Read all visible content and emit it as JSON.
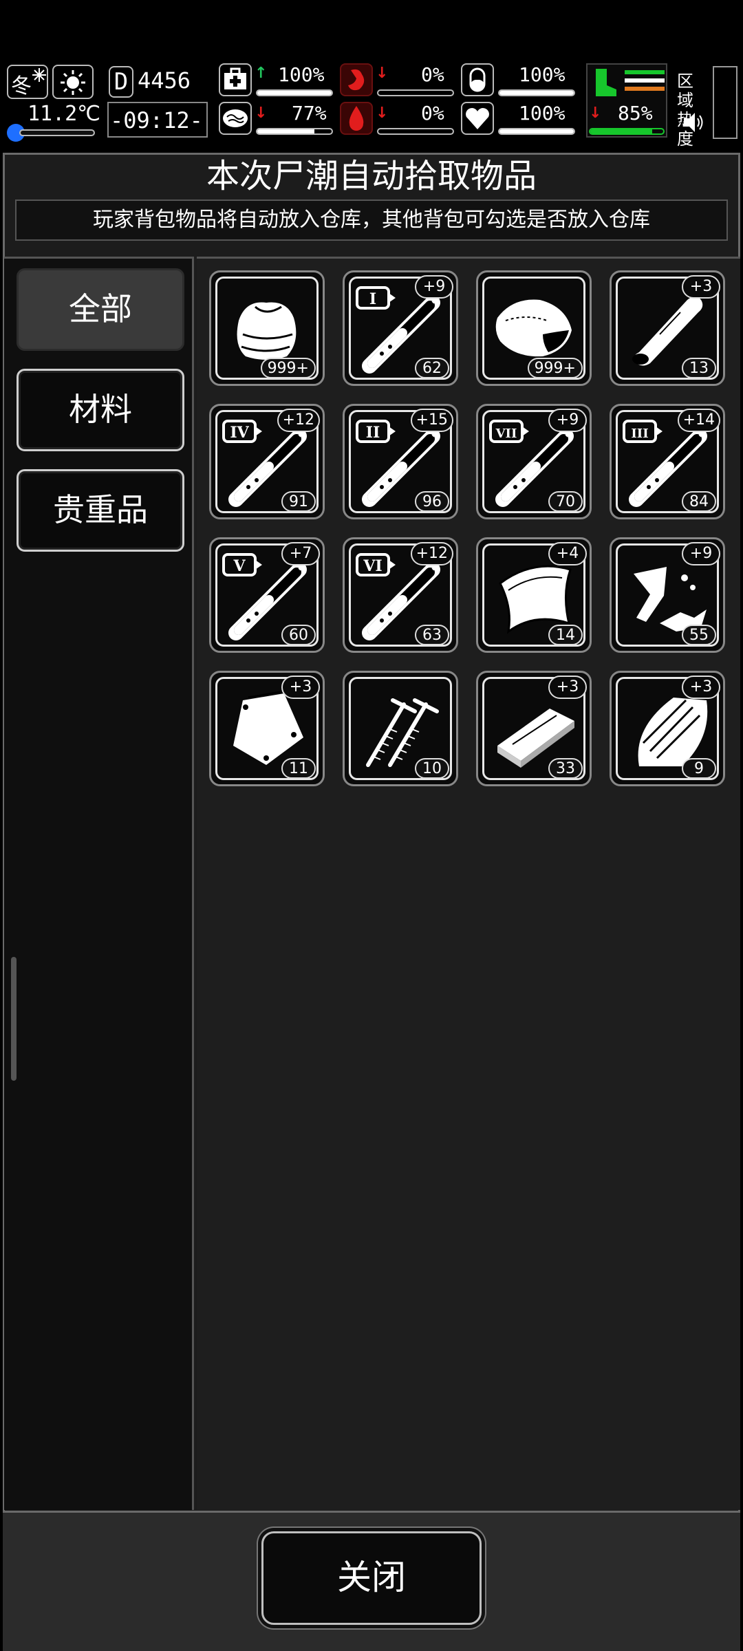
{
  "hud": {
    "season": "冬",
    "temperature": "11.2℃",
    "day": "4456",
    "time": "-09:12-",
    "stats": {
      "health": "100%",
      "stomach": "0%",
      "pill": "100%",
      "brain": "77%",
      "blood": "0%",
      "heart": "100%",
      "stamina": "85%"
    },
    "fills": {
      "health": 1.0,
      "stomach": 0.0,
      "pill": 1.0,
      "brain": 0.77,
      "blood": 0.0,
      "heart": 1.0,
      "stamina": 0.85
    },
    "zone_label": "区域热度",
    "colors": {
      "up": "#22c55e",
      "down": "#e11d1d",
      "accent_green": "#17c62c",
      "accent_orange": "#e07a1f"
    }
  },
  "dialog": {
    "title": "本次尸潮自动拾取物品",
    "subtitle": "玩家背包物品将自动放入仓库，其他背包可勾选是否放入仓库",
    "close_label": "关闭"
  },
  "tabs": [
    {
      "label": "全部",
      "active": true
    },
    {
      "label": "材料",
      "active": false
    },
    {
      "label": "贵重品",
      "active": false
    }
  ],
  "items": [
    {
      "icon": "cloth-icon",
      "badge": "",
      "count": "999+"
    },
    {
      "icon": "syringe-icon",
      "tier": "I",
      "badge": "+9",
      "count": "62"
    },
    {
      "icon": "meat-icon",
      "badge": "",
      "count": "999+"
    },
    {
      "icon": "bone-icon",
      "badge": "+3",
      "count": "13"
    },
    {
      "icon": "syringe-icon",
      "tier": "IV",
      "badge": "+12",
      "count": "91"
    },
    {
      "icon": "syringe-icon",
      "tier": "II",
      "badge": "+15",
      "count": "96"
    },
    {
      "icon": "syringe-icon",
      "tier": "VII",
      "badge": "+9",
      "count": "70"
    },
    {
      "icon": "syringe-icon",
      "tier": "III",
      "badge": "+14",
      "count": "84"
    },
    {
      "icon": "syringe-icon",
      "tier": "V",
      "badge": "+7",
      "count": "60"
    },
    {
      "icon": "syringe-icon",
      "tier": "VI",
      "badge": "+12",
      "count": "63"
    },
    {
      "icon": "leather-icon",
      "badge": "+4",
      "count": "14"
    },
    {
      "icon": "scrap-metal-icon",
      "badge": "+9",
      "count": "55"
    },
    {
      "icon": "bag-icon",
      "badge": "+3",
      "count": "11"
    },
    {
      "icon": "nails-icon",
      "badge": "",
      "count": "10"
    },
    {
      "icon": "wood-plank-icon",
      "badge": "+3",
      "count": "33"
    },
    {
      "icon": "wood-scrap-icon",
      "badge": "+3",
      "count": "9"
    }
  ]
}
